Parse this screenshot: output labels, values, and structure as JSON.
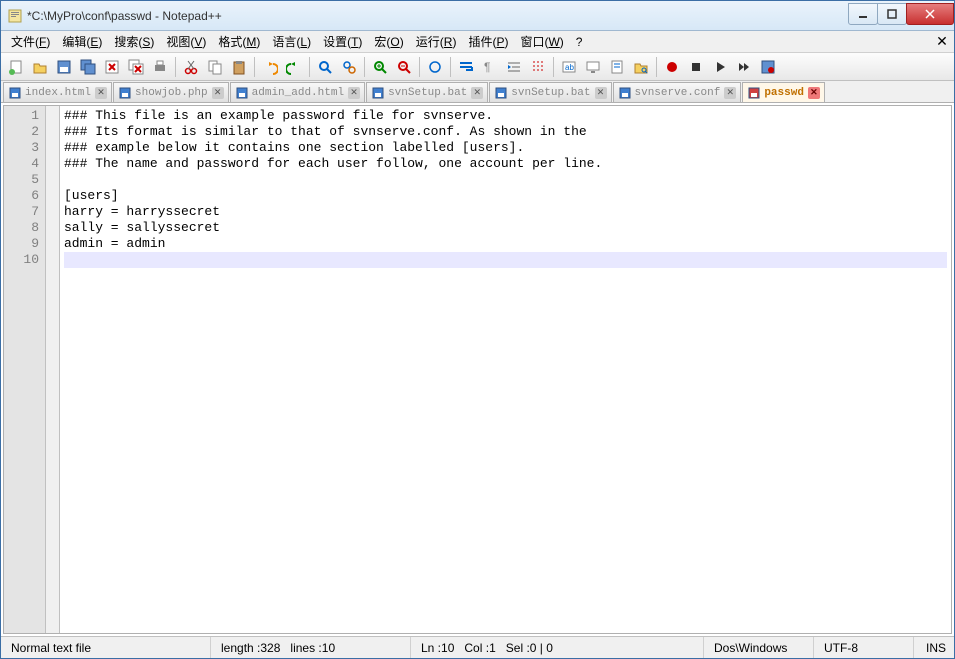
{
  "title": "*C:\\MyPro\\conf\\passwd - Notepad++",
  "menu": [
    {
      "label": "文件",
      "key": "F"
    },
    {
      "label": "编辑",
      "key": "E"
    },
    {
      "label": "搜索",
      "key": "S"
    },
    {
      "label": "视图",
      "key": "V"
    },
    {
      "label": "格式",
      "key": "M"
    },
    {
      "label": "语言",
      "key": "L"
    },
    {
      "label": "设置",
      "key": "T"
    },
    {
      "label": "宏",
      "key": "O"
    },
    {
      "label": "运行",
      "key": "R"
    },
    {
      "label": "插件",
      "key": "P"
    },
    {
      "label": "窗口",
      "key": "W"
    },
    {
      "label": "?",
      "key": ""
    }
  ],
  "toolbar_icons": [
    "new",
    "open",
    "save",
    "save-all",
    "close",
    "close-all",
    "print",
    "sep",
    "cut",
    "copy",
    "paste",
    "sep",
    "undo",
    "redo",
    "sep",
    "find",
    "replace",
    "sep",
    "zoom-in",
    "zoom-out",
    "sep",
    "sync",
    "sep",
    "wrap",
    "invisible",
    "indent",
    "guide",
    "sep",
    "lang",
    "monitor",
    "doc",
    "folder",
    "sep",
    "macro-rec",
    "macro-stop",
    "macro-play",
    "macro-fast",
    "macro-save"
  ],
  "tabs": [
    {
      "name": "index.html",
      "active": false,
      "saved": true
    },
    {
      "name": "showjob.php",
      "active": false,
      "saved": true
    },
    {
      "name": "admin_add.html",
      "active": false,
      "saved": true
    },
    {
      "name": "svnSetup.bat",
      "active": false,
      "saved": true
    },
    {
      "name": "svnSetup.bat",
      "active": false,
      "saved": true
    },
    {
      "name": "svnserve.conf",
      "active": false,
      "saved": true
    },
    {
      "name": "passwd",
      "active": true,
      "saved": false
    }
  ],
  "lines": [
    "### This file is an example password file for svnserve.",
    "### Its format is similar to that of svnserve.conf. As shown in the",
    "### example below it contains one section labelled [users].",
    "### The name and password for each user follow, one account per line.",
    "",
    "[users]",
    "harry = harryssecret",
    "sally = sallyssecret",
    "admin = admin",
    ""
  ],
  "current_line": 10,
  "status": {
    "filetype": "Normal text file",
    "length_label": "length : ",
    "length": "328",
    "lines_label": "lines : ",
    "lines": "10",
    "ln_label": "Ln : ",
    "ln": "10",
    "col_label": "Col : ",
    "col": "1",
    "sel_label": "Sel : ",
    "sel": "0 | 0",
    "eol": "Dos\\Windows",
    "encoding": "UTF-8",
    "mode": "INS"
  }
}
